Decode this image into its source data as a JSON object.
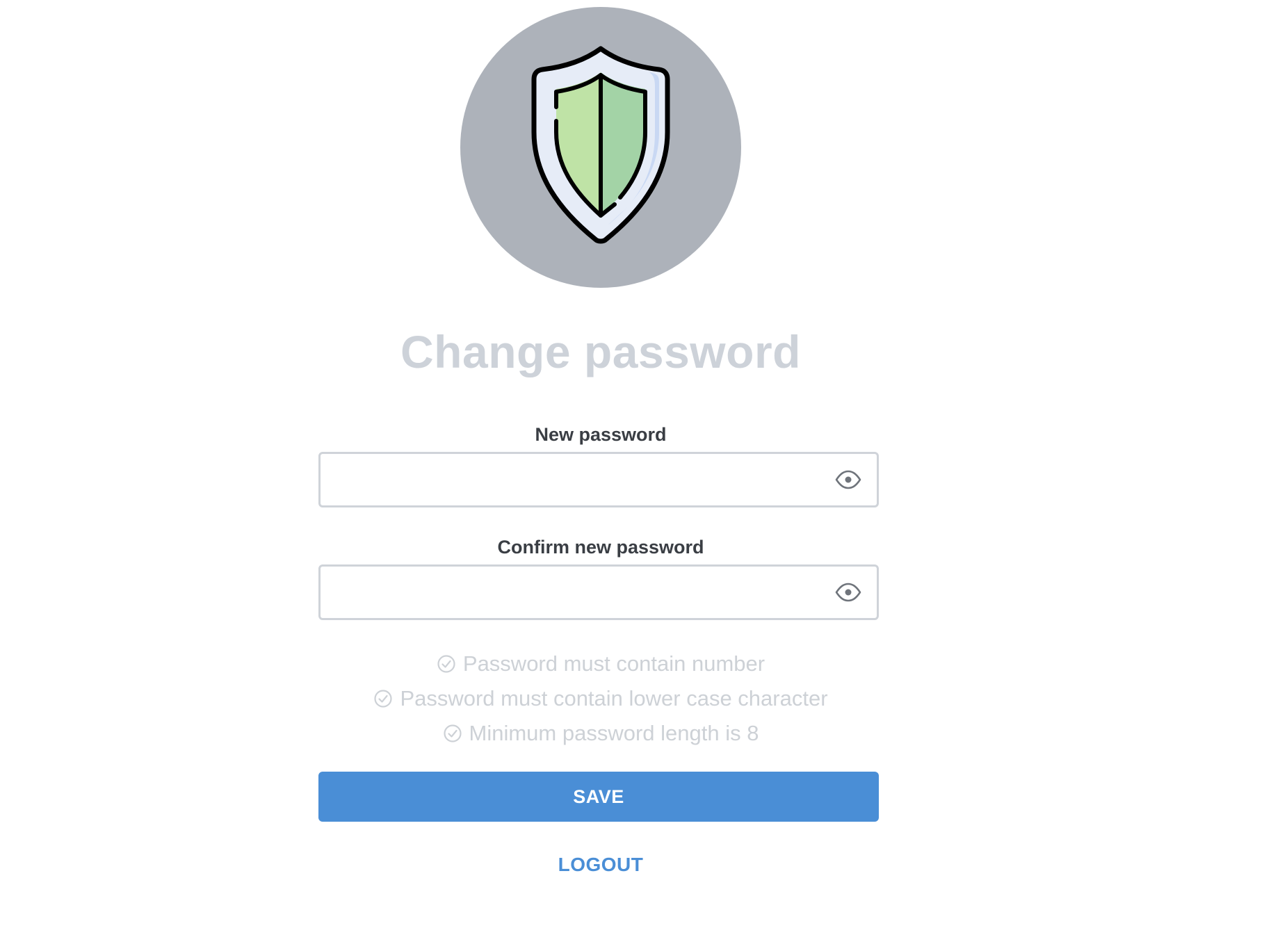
{
  "header": {
    "icon": "shield-icon",
    "title": "Change password"
  },
  "form": {
    "new_password": {
      "label": "New password",
      "value": "",
      "toggle_icon": "eye-icon"
    },
    "confirm_password": {
      "label": "Confirm new password",
      "value": "",
      "toggle_icon": "eye-icon"
    },
    "rules": [
      {
        "icon": "check-circle-icon",
        "text": "Password must contain number"
      },
      {
        "icon": "check-circle-icon",
        "text": "Password must contain lower case character"
      },
      {
        "icon": "check-circle-icon",
        "text": "Minimum password length is 8"
      }
    ],
    "save_label": "SAVE",
    "logout_label": "LOGOUT"
  },
  "colors": {
    "accent": "#4a8ed6",
    "hero_bg": "#adb2ba",
    "title": "#cdd2d9",
    "rule_text": "#cdd1d6",
    "shield_left": "#bfe3a6",
    "shield_right": "#a3d3a6"
  }
}
